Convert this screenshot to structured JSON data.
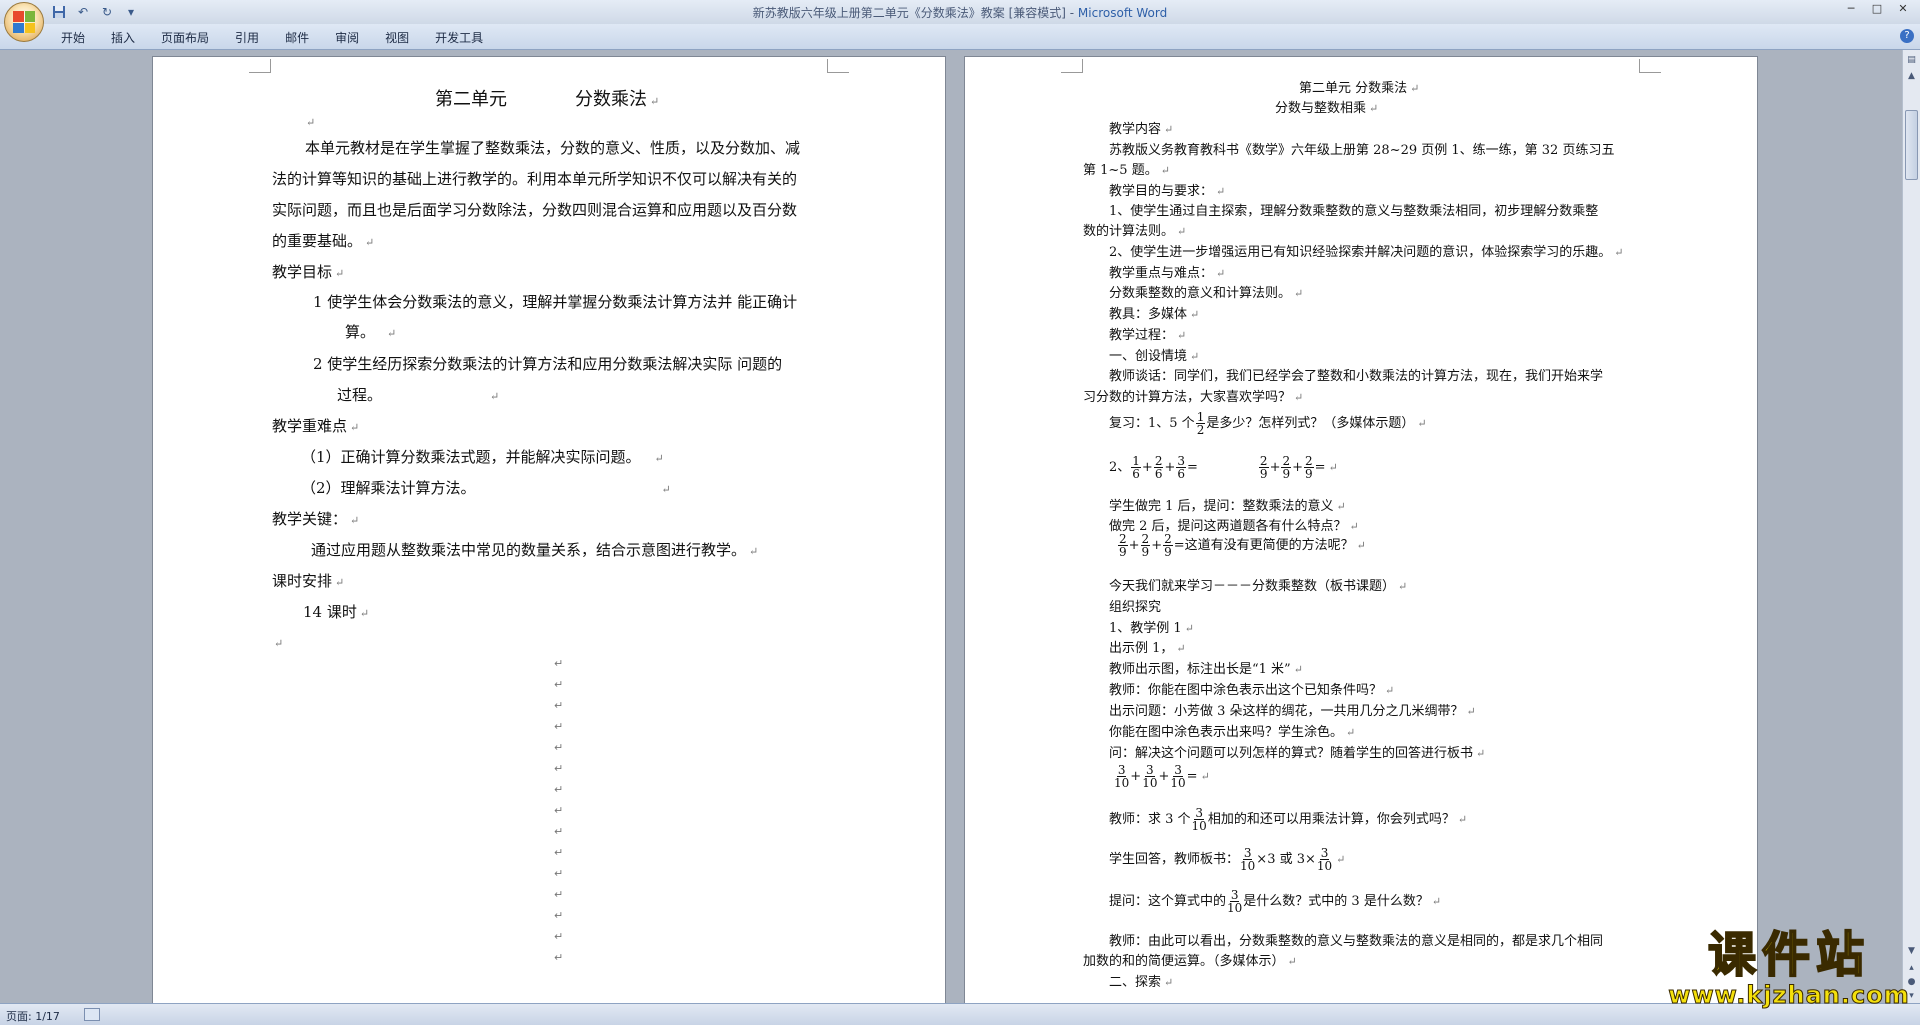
{
  "window": {
    "title": "新苏教版六年级上册第二单元《分数乘法》教案 [兼容模式] - ",
    "app": "Microsoft Word",
    "controls": [
      "─",
      "□",
      "✕"
    ]
  },
  "ribbon": {
    "tabs": [
      "开始",
      "插入",
      "页面布局",
      "引用",
      "邮件",
      "审阅",
      "视图",
      "开发工具"
    ]
  },
  "page1": {
    "title_left": "第二单元",
    "title_right": "分数乘法",
    "para1": [
      "本单元教材是在学生掌握了整数乘法，分数的意义、性质，以及分数加、减",
      "法的计算等知识的基础上进行教学的。利用本单元所学知识不仅可以解决有关的",
      "实际问题，而且也是后面学习分数除法，分数四则混合运算和应用题以及百分数",
      "的重要基础。"
    ],
    "goal_heading": "教学目标",
    "goal1": [
      "1 使学生体会分数乘法的意义，理解并掌握分数乘法计算方法并  能正确计",
      "算。"
    ],
    "goal2": [
      "2 使学生经历探索分数乘法的计算方法和应用分数乘法解决实际  问题的",
      "过程。"
    ],
    "key_heading": "教学重难点",
    "key1": "（1）正确计算分数乘法式题，并能解决实际问题。",
    "key2": "（2）理解乘法计算方法。",
    "crux_heading": "教学关键：",
    "crux": "通过应用题从整数乘法中常见的数量关系，结合示意图进行教学。",
    "schedule_heading": "课时安排",
    "schedule": "14 课时"
  },
  "page2": {
    "unit": "第二单元  分数乘法",
    "subtitle": "分数与整数相乘",
    "content_heading": "教学内容",
    "content": [
      "苏教版义务教育教科书《数学》六年级上册第 28~29 页例 1、练一练，第 32 页练习五",
      "第 1~5 题。"
    ],
    "aim_heading": "教学目的与要求：",
    "aim1": [
      "1、使学生通过自主探索，理解分数乘整数的意义与整数乘法相同，初步理解分数乘整",
      "数的计算法则。"
    ],
    "aim2": "2、使学生进一步增强运用已有知识经验探索并解决问题的意识，体验探索学习的乐趣。",
    "focus_heading": "教学重点与难点：",
    "focus": "分数乘整数的意义和计算法则。",
    "tools": "教具：多媒体",
    "process": "教学过程：",
    "sec1": "一、创设情境",
    "talk": [
      "教师谈话：同学们，我们已经学会了整数和小数乘法的计算方法，现在，我们开始来学",
      "习分数的计算方法，大家喜欢学吗？"
    ],
    "review_a": "复习：1、5 个",
    "review_b": "是多少？怎样列式？（多媒体示题）",
    "review2_label": "2、",
    "after1": "学生做完 1 后，提问：整数乘法的意义",
    "after2": "做完 2 后，提问这两道题各有什么特点？",
    "simpler": "=这道有没有更简便的方法呢？",
    "today": "今天我们就来学习－－－分数乘整数（板书课题）",
    "explore": "组织探究",
    "ex1": "1、教学例 1",
    "show": "出示例 1，",
    "teacher_fig": "教师出示图，标注出长是“1 米”",
    "q_color": "教师：你能在图中涂色表示出这个已知条件吗？",
    "q_problem": "出示问题：小芳做 3 朵这样的绸花，一共用几分之几米绸带？",
    "q_color2": "你能在图中涂色表示出来吗？学生涂色。",
    "q_formula": "问：解决这个问题可以列怎样的算式？随着学生的回答进行板书",
    "mult_a": "教师：求 3 个",
    "mult_b": "相加的和还可以用乘法计算，你会列式吗？",
    "answer_a": "学生回答，教师板书：",
    "answer_b": "×3 或 3×",
    "ask_a": "提问：这个算式中的",
    "ask_b": "是什么数？式中的 3 是什么数？",
    "conclude": [
      "教师：由此可以看出，分数乘整数的意义与整数乘法的意义是相同的，都是求几个相同",
      "加数的和的简便运算。（多媒体示）"
    ],
    "sec2": "二、探索",
    "f12": [
      "1",
      "2"
    ],
    "f16": [
      "1",
      "6"
    ],
    "f26": [
      "2",
      "6"
    ],
    "f36": [
      "3",
      "6"
    ],
    "f29": [
      "2",
      "9"
    ],
    "f310": [
      "3",
      "10"
    ]
  },
  "status": {
    "page": "页面: 1/17"
  },
  "watermark": {
    "title": "课件站",
    "url": "www.kjzhan.com"
  }
}
